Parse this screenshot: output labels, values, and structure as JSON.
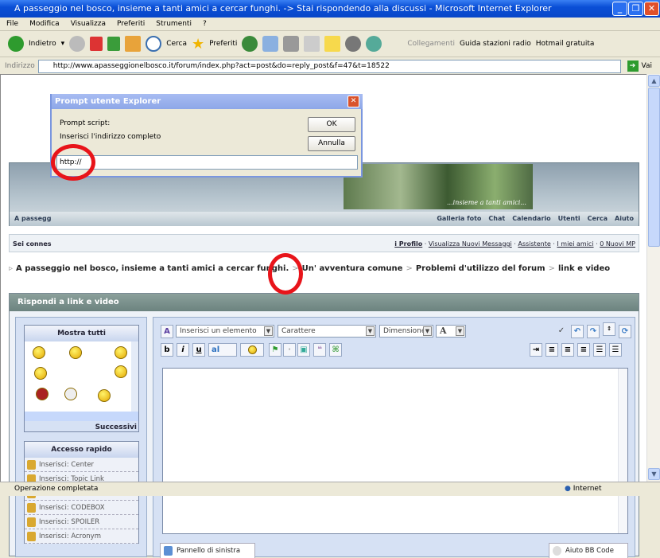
{
  "window": {
    "title": "A passeggio nel bosco, insieme a tanti amici a cercar funghi. -> Stai rispondendo alla discussi - Microsoft Internet Explorer",
    "controls": [
      "minimize",
      "maximize",
      "close"
    ]
  },
  "menu": [
    "File",
    "Modifica",
    "Visualizza",
    "Preferiti",
    "Strumenti",
    "?"
  ],
  "toolbar": {
    "back": "Indietro",
    "search": "Cerca",
    "favorites": "Preferiti",
    "links_label": "Collegamenti",
    "link1": "Guida stazioni radio",
    "link2": "Hotmail gratuita"
  },
  "address": {
    "label": "Indirizzo",
    "url": "http://www.apasseggionelbosco.it/forum/index.php?act=post&do=reply_post&f=47&t=18522",
    "go": "Vai"
  },
  "banner": {
    "tagline": "...insieme a tanti amici...",
    "site_short": "A passegg",
    "nav": [
      "Galleria foto",
      "Chat",
      "Calendario",
      "Utenti",
      "Cerca",
      "Aiuto"
    ]
  },
  "userbar": {
    "left": "Sei connes",
    "links": [
      "i Profilo",
      "Visualizza Nuovi Messaggi",
      "Assistente",
      "I miei amici",
      "0 Nuovi MP"
    ]
  },
  "breadcrumb": [
    "A passeggio nel bosco, insieme a tanti amici a cercar funghi.",
    "Un' avventura comune",
    "Problemi d'utilizzo del forum",
    "link e video"
  ],
  "form": {
    "title": "Rispondi a link e video",
    "emoticons": {
      "header": "Mostra tutti",
      "next": "Successivi"
    },
    "quick": {
      "header": "Accesso rapido",
      "items": [
        "Inserisci: Center",
        "Inserisci: Topic Link",
        "Inserisci: Post Link",
        "Inserisci: CODEBOX",
        "Inserisci: SPOILER",
        "Inserisci: Acronym"
      ]
    },
    "editor": {
      "insert_element": "Inserisci un elemento",
      "font": "Carattere",
      "size": "Dimensione",
      "color": "A",
      "bold": "b",
      "italic": "i",
      "underline": "u",
      "text_color": "al",
      "body": ""
    },
    "tabs": {
      "left_panel": "Pannello di sinistra",
      "help": "Aiuto BB Code"
    }
  },
  "dialog": {
    "title": "Prompt utente Explorer",
    "label1": "Prompt script:",
    "label2": "Inserisci l'indirizzo completo",
    "ok": "OK",
    "cancel": "Annulla",
    "value": "http://"
  },
  "annotation_color": "#e8141a",
  "status": {
    "text": "Operazione completata",
    "zone": "Internet"
  }
}
